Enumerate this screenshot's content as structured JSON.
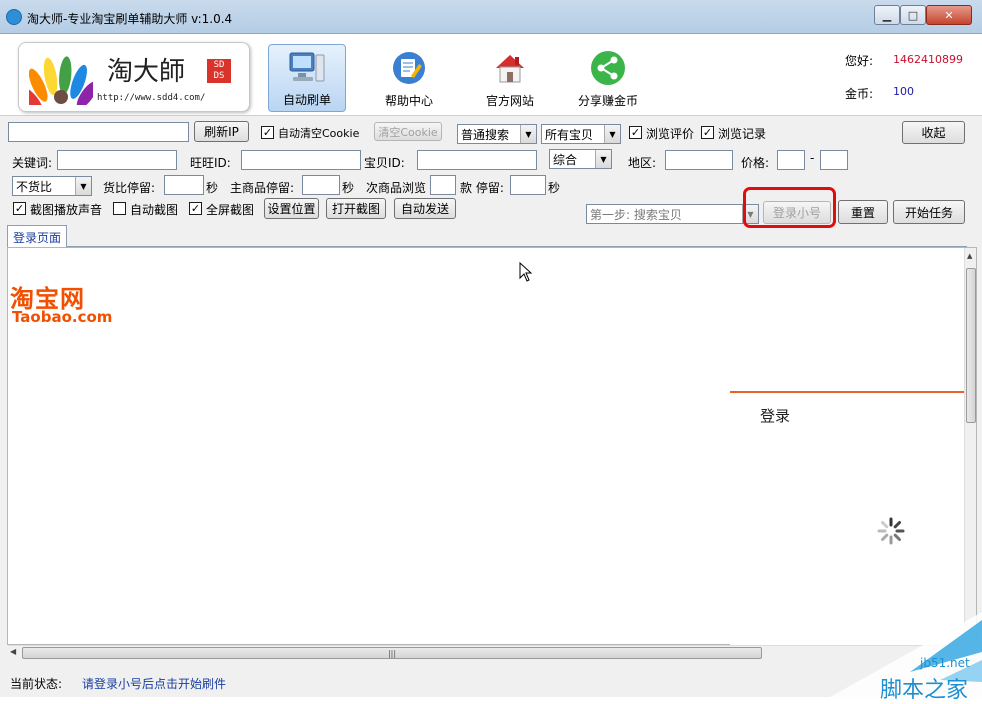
{
  "window": {
    "title": "淘大师-专业淘宝刷单辅助大师 v:1.0.4",
    "min_glyph": "▁",
    "max_glyph": "□",
    "close_glyph": "✕"
  },
  "logo": {
    "name": "淘大師",
    "badge": "SD DS",
    "url": "http://www.sdd4.com/"
  },
  "nav": [
    {
      "label": "自动刷单",
      "icon": "computer-icon",
      "active": true
    },
    {
      "label": "帮助中心",
      "icon": "help-edit-icon"
    },
    {
      "label": "官方网站",
      "icon": "home-icon"
    },
    {
      "label": "分享赚金币",
      "icon": "share-icon"
    }
  ],
  "account": {
    "hello_label": "您好:",
    "user": "1462410899",
    "gold_label": "金币:",
    "gold": "100"
  },
  "row1": {
    "ip_input": "",
    "refresh_ip": "刷新IP",
    "auto_clear_cookie": "自动清空Cookie",
    "clear_cookie": "清空Cookie",
    "search_type": "普通搜索",
    "goods_scope": "所有宝贝",
    "browse_reviews": "浏览评价",
    "browse_history": "浏览记录",
    "collapse": "收起"
  },
  "row2": {
    "keyword_label": "关键词:",
    "wangwang_label": "旺旺ID:",
    "item_id_label": "宝贝ID:",
    "sort": "综合",
    "region_label": "地区:",
    "price_label": "价格:",
    "price_sep": "-"
  },
  "row3": {
    "compare": "不货比",
    "compare_stay_label": "货比停留:",
    "sec1": "秒",
    "main_stay_label": "主商品停留:",
    "sec2": "秒",
    "sub_browse_label": "次商品浏览",
    "items_label": "款 停留:",
    "sec3": "秒"
  },
  "row4": {
    "screenshot_sound": "截图播放声音",
    "auto_screenshot": "自动截图",
    "full_screenshot": "全屏截图",
    "set_position": "设置位置",
    "open_screenshot": "打开截图",
    "auto_send": "自动发送",
    "step_select": "第一步: 搜索宝贝",
    "login_account": "登录小号",
    "reset": "重置",
    "start_task": "开始任务"
  },
  "tabs": [
    {
      "label": "登录页面"
    }
  ],
  "page": {
    "brand_cn": "淘宝网",
    "brand_en": "Taobao.com",
    "login_title": "登录"
  },
  "status": {
    "label": "当前状态:",
    "text": "请登录小号后点击开始刷件"
  },
  "watermark": {
    "text": "脚本之家",
    "url": "jb51.net"
  },
  "colors": {
    "taobao_orange": "#f24f00",
    "highlight_red": "#e10d0d",
    "user_red": "#c8102e"
  }
}
